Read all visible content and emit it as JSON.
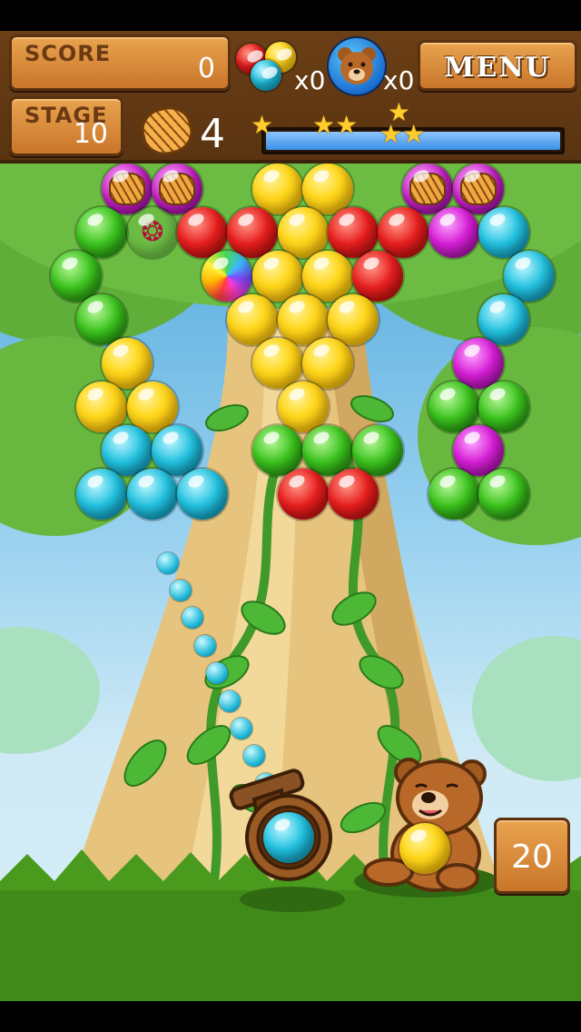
{
  "hud": {
    "score_label": "SCORE",
    "score_value": "0",
    "stage_label": "STAGE",
    "stage_value": "10",
    "bomb_count": "x0",
    "bear_count": "x0",
    "menu_label": "MENU",
    "honey_remaining": "4",
    "progress_fraction": 0.0,
    "star_thresholds": 3
  },
  "board": {
    "rows": [
      [
        "honey",
        "honey",
        null,
        "yellow",
        "yellow",
        null,
        null,
        "honey",
        "honey"
      ],
      [
        "green",
        "paw",
        "red",
        "red",
        "yellow",
        "red",
        "red",
        "purple",
        "cyan"
      ],
      [
        "green",
        null,
        null,
        "rainbow",
        "yellow",
        "yellow",
        "red",
        null,
        null,
        "cyan"
      ],
      [
        "green",
        null,
        null,
        "yellow",
        "yellow",
        "yellow",
        null,
        null,
        "cyan"
      ],
      [
        null,
        "yellow",
        null,
        null,
        "yellow",
        "yellow",
        null,
        null,
        "purple"
      ],
      [
        "yellow",
        "yellow",
        null,
        null,
        "yellow",
        null,
        null,
        "green",
        "green"
      ],
      [
        null,
        "cyan",
        "cyan",
        null,
        "green",
        "green",
        "green",
        null,
        "purple"
      ],
      [
        "cyan",
        "cyan",
        "cyan",
        null,
        null,
        "red",
        "red",
        null,
        "green",
        "green"
      ]
    ]
  },
  "shooter": {
    "loaded_bubble": "cyan",
    "next_bubble": "yellow",
    "shots_remaining": "20"
  },
  "colors": {
    "hud_wood": "#c9762a",
    "progress_fill": "#3a8fe6",
    "ground_green": "#4a9a1e"
  }
}
